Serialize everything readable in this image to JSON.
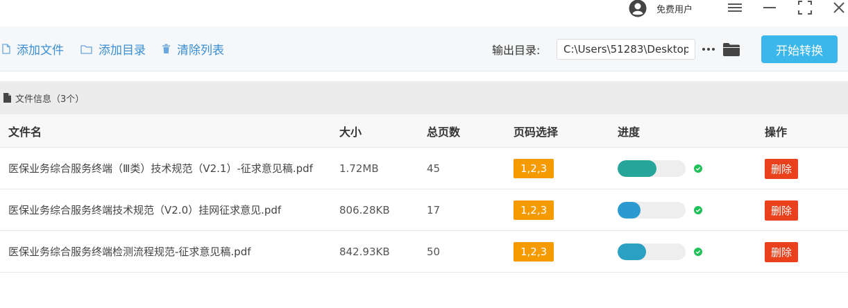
{
  "window": {
    "user_label": "免费用户"
  },
  "toolbar": {
    "add_file": "添加文件",
    "add_dir": "添加目录",
    "clear_list": "清除列表",
    "output_label": "输出目录:",
    "output_path": "C:\\Users\\51283\\Desktop",
    "start": "开始转换"
  },
  "section": {
    "title": "文件信息（3个）"
  },
  "table": {
    "columns": [
      "文件名",
      "大小",
      "总页数",
      "页码选择",
      "进度",
      "操作"
    ],
    "rows": [
      {
        "name": "医保业务综合服务终端（Ⅲ类）技术规范（V2.1）-征求意见稿.pdf",
        "size": "1.72MB",
        "pages": "45",
        "page_select": "1,2,3",
        "progress": 0.57,
        "progress_color": "#26a69a",
        "action": "删除"
      },
      {
        "name": "医保业务综合服务终端技术规范（V2.0）挂网征求意见.pdf",
        "size": "806.28KB",
        "pages": "17",
        "page_select": "1,2,3",
        "progress": 0.34,
        "progress_color": "#2a9ad1",
        "action": "删除"
      },
      {
        "name": "医保业务综合服务终端检测流程规范-征求意见稿.pdf",
        "size": "842.93KB",
        "pages": "50",
        "page_select": "1,2,3",
        "progress": 0.42,
        "progress_color": "#2aa0c2",
        "action": "删除"
      }
    ]
  },
  "colors": {
    "accent": "#3bb7ec",
    "link": "#3a8fd6",
    "badge": "#f59b00",
    "danger": "#e8411c",
    "success": "#21c15a"
  }
}
